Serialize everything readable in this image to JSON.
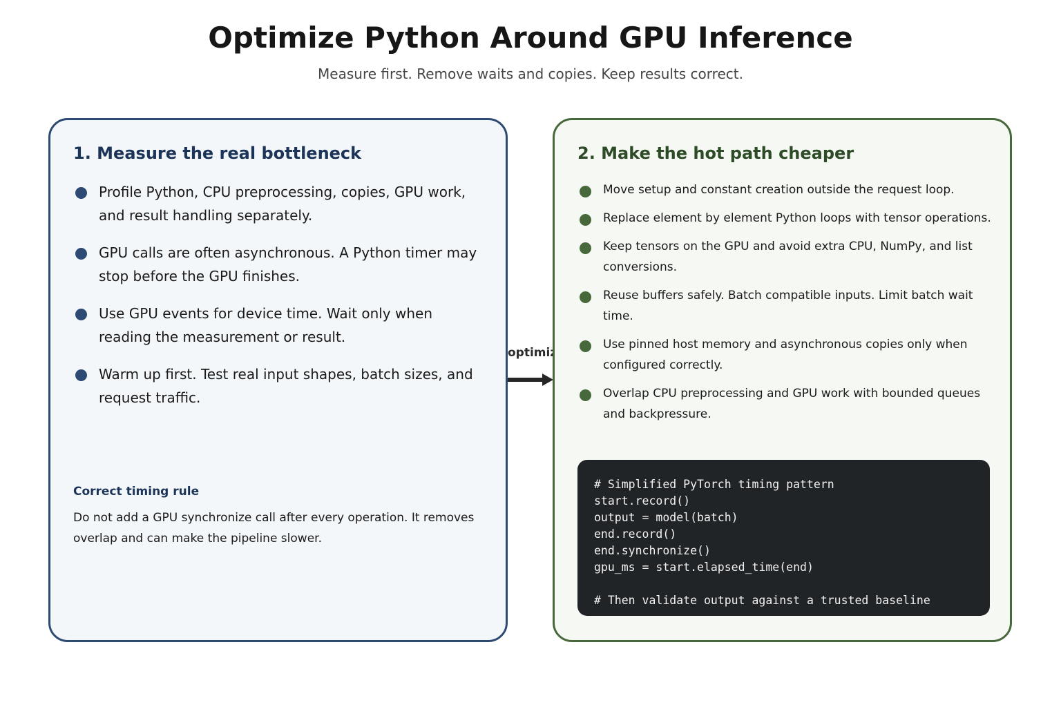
{
  "header": {
    "title": "Optimize Python Around GPU Inference",
    "subtitle": "Measure first. Remove waits and copies. Keep results correct."
  },
  "left_panel": {
    "heading": "1. Measure the real bottleneck",
    "items": [
      "Profile Python, CPU preprocessing, copies, GPU work, and result handling separately.",
      "GPU calls are often asynchronous. A Python timer may stop before the GPU finishes.",
      "Use GPU events for device time. Wait only when reading the measurement or result.",
      "Warm up first. Test real input shapes, batch sizes, and request traffic."
    ],
    "rule_title": "Correct timing rule",
    "rule_text": "Do not add a GPU synchronize call after every operation. It removes overlap and can make the pipeline slower."
  },
  "connector": {
    "label": "optimize"
  },
  "right_panel": {
    "heading": "2. Make the hot path cheaper",
    "items": [
      "Move setup and constant creation outside the request loop.",
      "Replace element by element Python loops with tensor operations.",
      "Keep tensors on the GPU and avoid extra CPU, NumPy, and list conversions.",
      "Reuse buffers safely. Batch compatible inputs. Limit batch wait time.",
      "Use pinned host memory and asynchronous copies only when configured correctly.",
      "Overlap CPU preprocessing and GPU work with bounded queues and backpressure."
    ],
    "code_lines": [
      "# Simplified PyTorch timing pattern",
      "start.record()",
      "output = model(batch)",
      "end.record()",
      "end.synchronize()",
      "gpu_ms = start.elapsed_time(end)",
      "",
      "# Then validate output against a trusted baseline"
    ]
  },
  "colors": {
    "left_accent": "#2c4a72",
    "right_accent": "#47683a",
    "code_background": "#212427"
  }
}
